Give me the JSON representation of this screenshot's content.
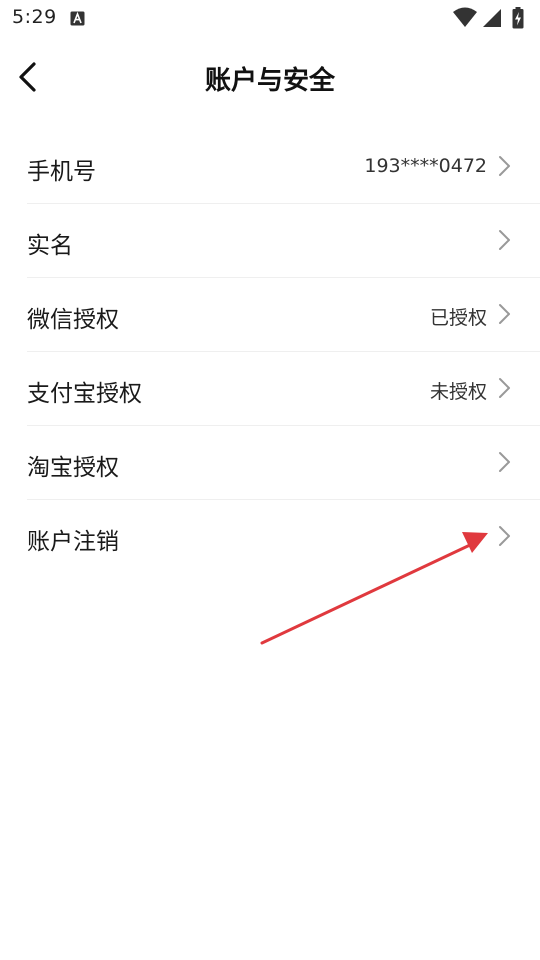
{
  "status_bar": {
    "time": "5:29"
  },
  "header": {
    "title": "账户与安全"
  },
  "menu": {
    "items": [
      {
        "label": "手机号",
        "value": "193****0472"
      },
      {
        "label": "实名",
        "value": ""
      },
      {
        "label": "微信授权",
        "value": "已授权"
      },
      {
        "label": "支付宝授权",
        "value": "未授权"
      },
      {
        "label": "淘宝授权",
        "value": ""
      },
      {
        "label": "账户注销",
        "value": ""
      }
    ]
  },
  "colors": {
    "annotation_arrow": "#e0393e",
    "divider": "#efefef",
    "chevron": "#999999"
  },
  "icons": {
    "back": "chevron-left-icon",
    "row": "chevron-right-icon"
  }
}
